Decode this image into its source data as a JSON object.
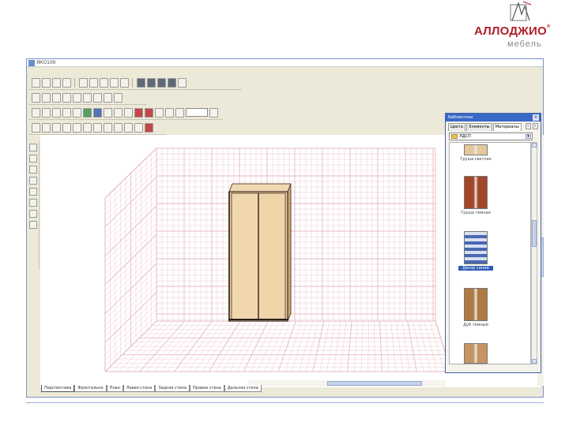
{
  "brand": {
    "name": "АЛЛОДЖИО",
    "reg_mark": "®",
    "subtitle": "мебель",
    "accent_color": "#b01e2a"
  },
  "window": {
    "title": "ЯКО100"
  },
  "canvas": {
    "grid_color": "#e8b9c2",
    "wardrobe_color": "#e9caa0"
  },
  "tabs": [
    "Перспектива",
    "Фронтально",
    "План",
    "Левая стена",
    "Задняя стена",
    "Правая стена",
    "Дальняя стена"
  ],
  "materials_panel": {
    "title": "Библиотеки",
    "tabs": [
      "Цвета",
      "Элементы",
      "Материалы"
    ],
    "folder": "ЛДСП",
    "close_label": "×",
    "items": [
      {
        "label": "Груша светлая",
        "color": "#e6c79c",
        "selected": false
      },
      {
        "label": "Груша темная",
        "color": "#a2462a",
        "selected": false
      },
      {
        "label": "Декор синий",
        "color": "#8aa4d8",
        "selected": true
      },
      {
        "label": "Дуб темный",
        "color": "#b07a45",
        "selected": false
      },
      {
        "label": "",
        "color": "#c69462",
        "selected": false
      }
    ]
  },
  "toolbar_icons": [
    "new-file",
    "open",
    "save",
    "print",
    "cut",
    "copy",
    "paste",
    "undo",
    "redo",
    "zoom"
  ]
}
